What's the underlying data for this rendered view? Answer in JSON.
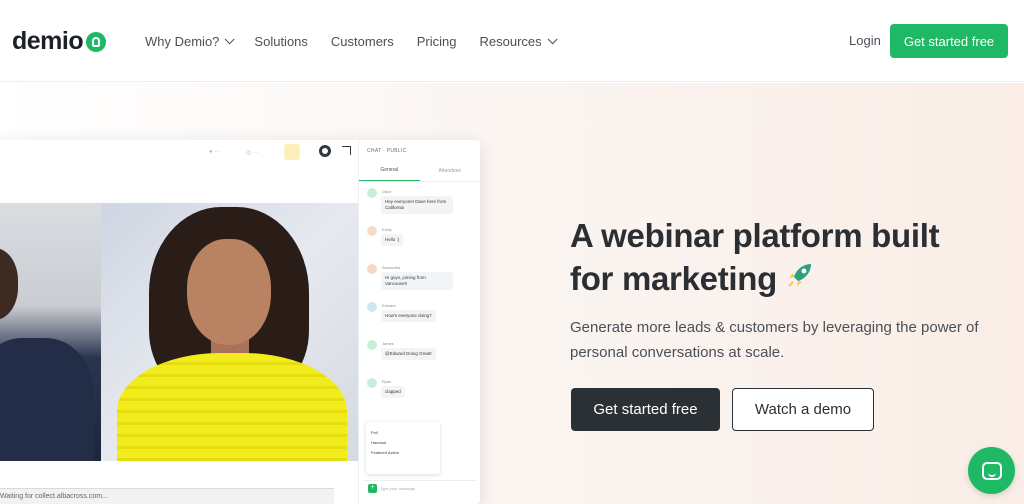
{
  "brand": {
    "logo_text": "demio",
    "accent": "#1fb865"
  },
  "nav": {
    "items": [
      {
        "label": "Why Demio?",
        "dropdown": true
      },
      {
        "label": "Solutions",
        "dropdown": false
      },
      {
        "label": "Customers",
        "dropdown": false
      },
      {
        "label": "Pricing",
        "dropdown": false
      },
      {
        "label": "Resources",
        "dropdown": true
      }
    ],
    "login": "Login",
    "cta": "Get started free"
  },
  "hero": {
    "headline_line1": "A webinar platform built",
    "headline_line2": "for marketing",
    "headline_icon": "rocket-icon",
    "subtitle": "Generate more leads & customers by leveraging the power of personal conversations at scale.",
    "primary_cta": "Get started free",
    "secondary_cta": "Watch a demo"
  },
  "app_preview": {
    "chat_header": "CHAT · PUBLIC",
    "tabs": [
      "General",
      "Attendees"
    ],
    "messages": [
      {
        "name": "Dave",
        "text": "Hey everyone! Dave here from California"
      },
      {
        "name": "Emily",
        "text": "Hello :)"
      },
      {
        "name": "Samantha",
        "text": "Hi guys, joining from Vancouver!"
      },
      {
        "name": "Edward",
        "text": "How's everyone doing?"
      },
      {
        "name": "James",
        "text": "@Edward Doing Great!"
      },
      {
        "name": "Ryan",
        "text": "clapped"
      }
    ],
    "poll_items": [
      "Poll",
      "Handout",
      "Featured Action"
    ],
    "input_placeholder": "Type your message...",
    "status_bar": "Waiting for collect.albacross.com..."
  }
}
